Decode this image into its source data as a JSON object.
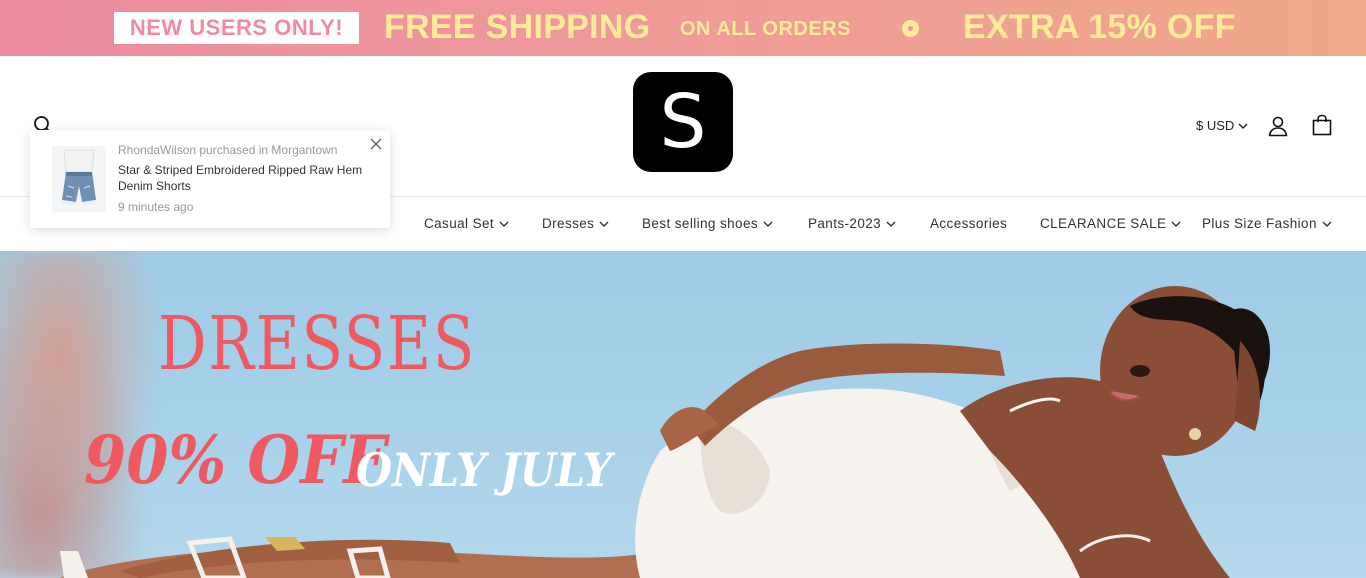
{
  "promo": {
    "badge": "NEW USERS ONLY!",
    "free_shipping": "FREE SHIPPING",
    "on_all_orders": "ON ALL ORDERS",
    "extra": "EXTRA 15% OFF"
  },
  "header": {
    "logo_letter": "S",
    "currency": "$ USD"
  },
  "nav": {
    "items": [
      {
        "label": "Casual Set",
        "has_dropdown": true
      },
      {
        "label": "Dresses",
        "has_dropdown": true
      },
      {
        "label": "Best selling shoes",
        "has_dropdown": true
      },
      {
        "label": "Pants-2023",
        "has_dropdown": true
      },
      {
        "label": "Accessories",
        "has_dropdown": false
      },
      {
        "label": "CLEARANCE SALE",
        "has_dropdown": true
      },
      {
        "label": "Plus Size Fashion",
        "has_dropdown": true
      }
    ]
  },
  "popup": {
    "meta": "RhondaWilson purchased in Morgantown",
    "title": "Star & Striped Embroidered Ripped Raw Hem Denim Shorts",
    "time": "9 minutes ago"
  },
  "hero": {
    "headline": "DRESSES",
    "discount": "90% OFF",
    "period": "ONLY JULY"
  },
  "colors": {
    "accent": "#ef5a62",
    "promo_text": "#fdeb9a",
    "promo_badge_text": "#f08aa0"
  }
}
